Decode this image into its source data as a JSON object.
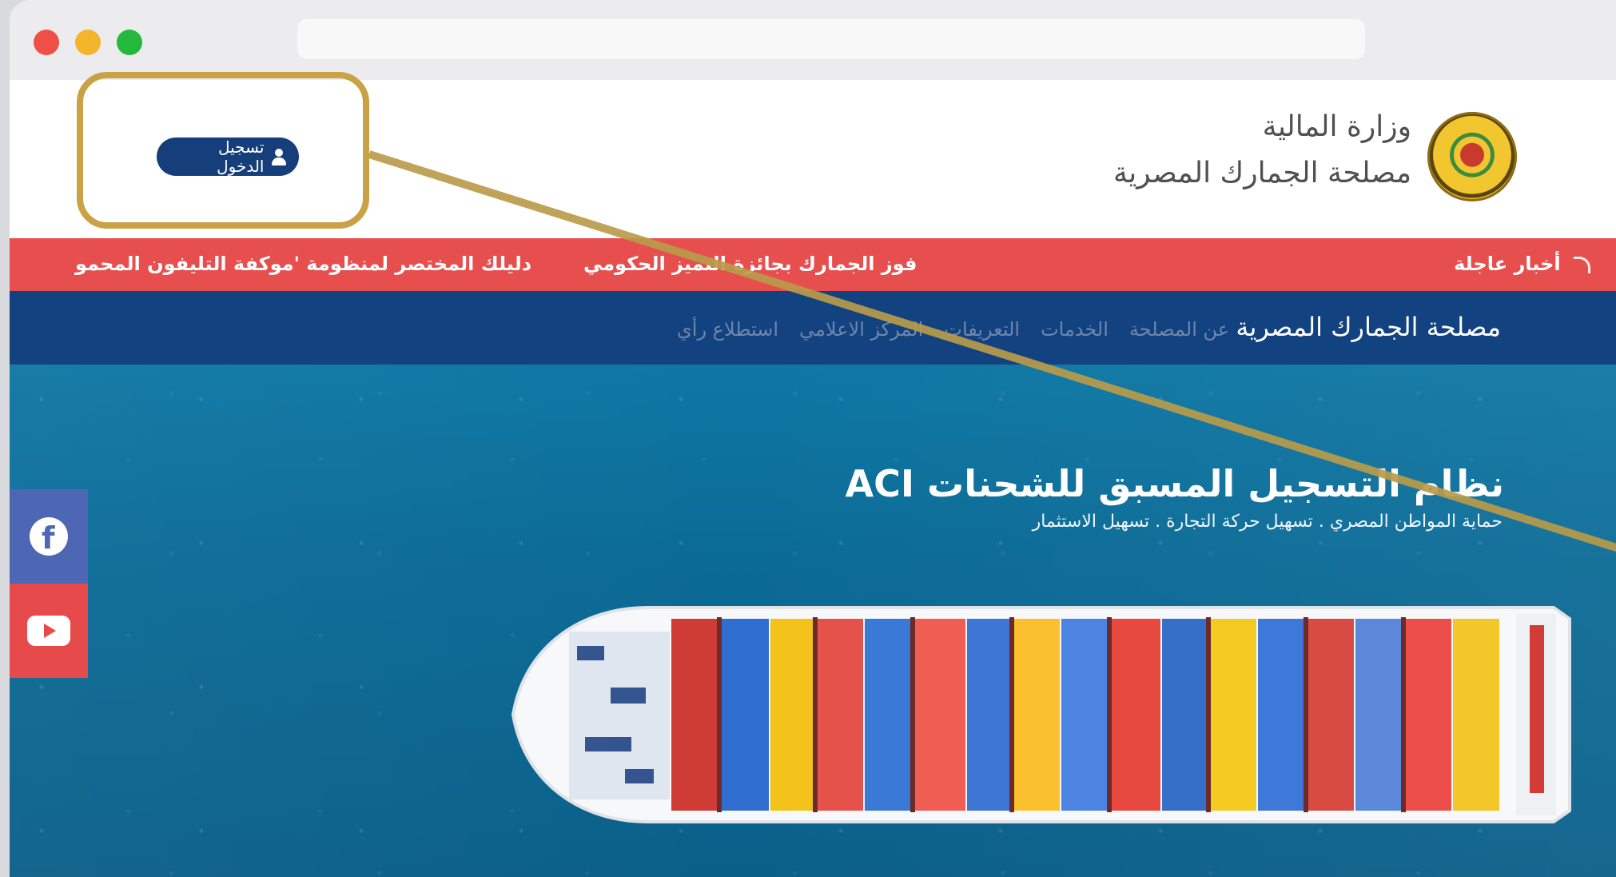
{
  "header": {
    "ministry": "وزارة المالية",
    "authority": "مصلحة الجمارك المصرية",
    "login_button": "تسجيل الدخول"
  },
  "breaking": {
    "label": "أخبار عاجلة",
    "headline_1": "فوز الجمارك بجائزة التميز الحكومي",
    "headline_2": "دليلك المختصر لمنظومة 'موكفة التليفون المحمو"
  },
  "nav": {
    "brand": "مصلحة الجمارك المصرية",
    "items": [
      "عن المصلحة",
      "الخدمات",
      "التعريفات",
      "المركز الاعلامي",
      "استطلاع رأي"
    ]
  },
  "hero": {
    "title": "نظام التسجيل المسبق للشحنات ACI",
    "subtitle": "حماية المواطن المصري . تسهيل حركة التجارة . تسهيل الاستثمار"
  },
  "social": {
    "facebook_icon": "facebook-icon",
    "youtube_icon": "youtube-icon"
  },
  "colors": {
    "header_bg": "#ffffff",
    "breaking_bg": "#e74f4f",
    "nav_bg": "#12427f",
    "highlight": "#c9a245"
  }
}
